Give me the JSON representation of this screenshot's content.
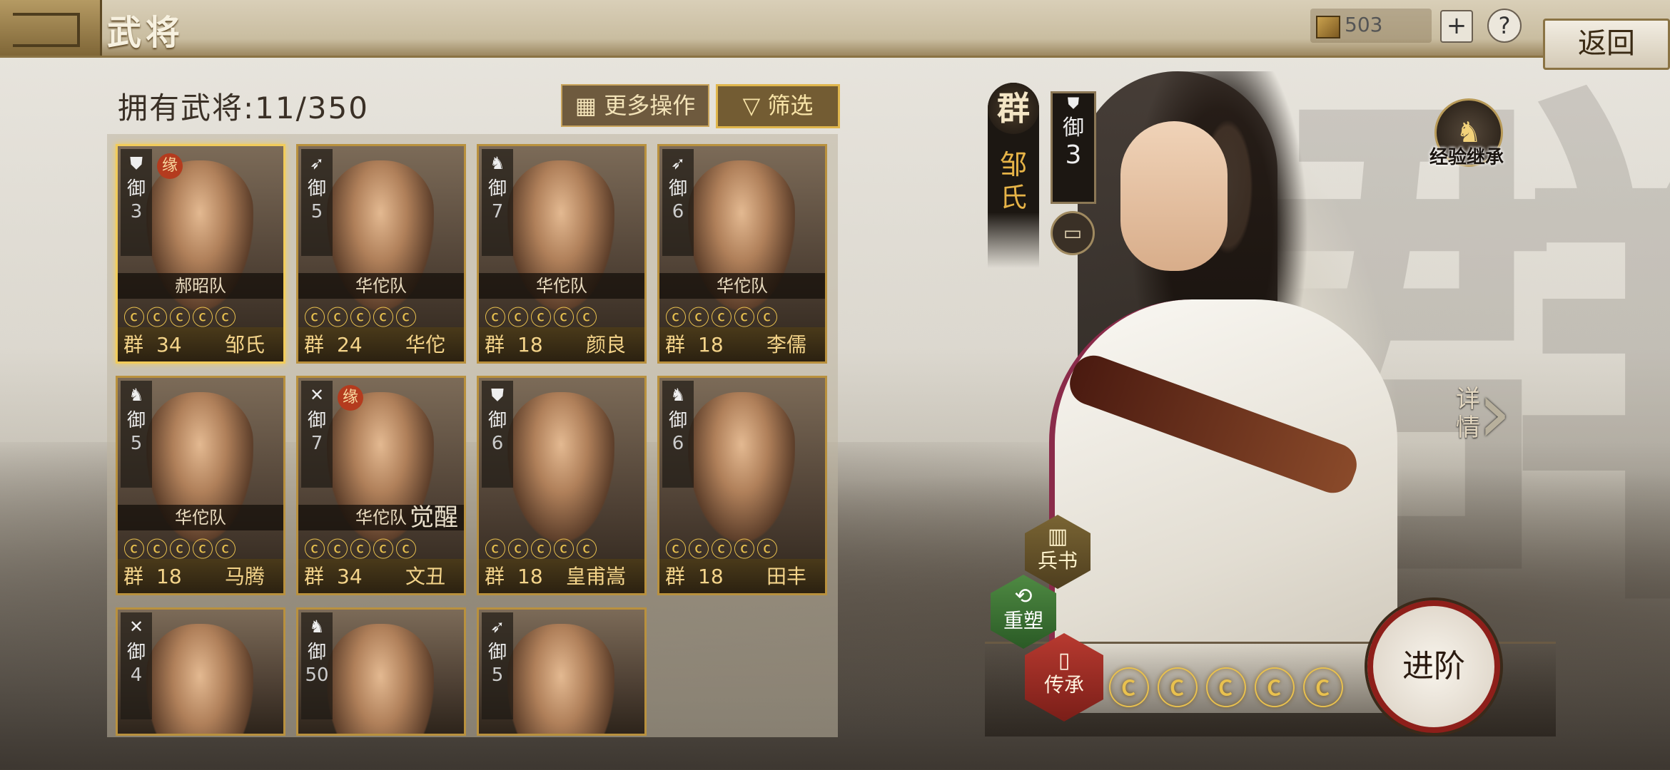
{
  "header": {
    "title": "武将",
    "currency_value": "503",
    "plus_label": "+",
    "help_label": "?",
    "back_label": "返回"
  },
  "panel": {
    "owned_label": "拥有武将:11/350",
    "more_label": "更多操作",
    "filter_label": "筛选"
  },
  "cards": [
    {
      "unit": "御",
      "cost": "3",
      "team": "郝昭队",
      "stars": "ⓒⓒⓒⓒⓒ",
      "faction": "群",
      "level": "34",
      "name": "邹氏",
      "icon": "shield-icon",
      "selected": true,
      "marker": "缘"
    },
    {
      "unit": "御",
      "cost": "5",
      "team": "华佗队",
      "stars": "ⓒⓒⓒⓒⓒ",
      "faction": "群",
      "level": "24",
      "name": "华佗",
      "icon": "bow-icon"
    },
    {
      "unit": "御",
      "cost": "7",
      "team": "华佗队",
      "stars": "ⓒⓒⓒⓒⓒ",
      "faction": "群",
      "level": "18",
      "name": "颜良",
      "icon": "horse-icon"
    },
    {
      "unit": "御",
      "cost": "6",
      "team": "华佗队",
      "stars": "ⓒⓒⓒⓒⓒ",
      "faction": "群",
      "level": "18",
      "name": "李儒",
      "icon": "bow-icon"
    },
    {
      "unit": "御",
      "cost": "5",
      "team": "华佗队",
      "stars": "ⓒⓒⓒⓒⓒ",
      "faction": "群",
      "level": "18",
      "name": "马腾",
      "icon": "horse-icon"
    },
    {
      "unit": "御",
      "cost": "7",
      "team": "华佗队",
      "stars": "ⓒⓒⓒⓒⓒ",
      "faction": "群",
      "level": "34",
      "name": "文丑",
      "icon": "spear-icon",
      "marker": "缘",
      "awake": "觉醒"
    },
    {
      "unit": "御",
      "cost": "6",
      "team": "",
      "stars": "ⓒⓒⓒⓒⓒ",
      "faction": "群",
      "level": "18",
      "name": "皇甫嵩",
      "icon": "shield-icon"
    },
    {
      "unit": "御",
      "cost": "6",
      "team": "",
      "stars": "ⓒⓒⓒⓒⓒ",
      "faction": "群",
      "level": "18",
      "name": "田丰",
      "icon": "horse-icon"
    },
    {
      "unit": "御",
      "cost": "4",
      "team": "",
      "stars": "",
      "faction": "",
      "level": "",
      "name": "",
      "icon": "spear-icon"
    },
    {
      "unit": "御",
      "cost": "50",
      "team": "",
      "stars": "",
      "faction": "",
      "level": "",
      "name": "",
      "icon": "horse-icon"
    },
    {
      "unit": "御",
      "cost": "5",
      "team": "",
      "stars": "",
      "faction": "",
      "level": "",
      "name": "",
      "icon": "bow-icon"
    }
  ],
  "hero": {
    "faction": "群",
    "name": "邹氏",
    "unit": "御",
    "cost": "3",
    "exp_label": "经验继承",
    "detail_label": "详情",
    "book_label": "兵书",
    "reshape_label": "重塑",
    "inherit_label": "传承",
    "stars": "ⓒⓒⓒⓒⓒ",
    "advance_label": "进阶"
  },
  "colors": {
    "gold": "#e9c14e",
    "frame": "#b9913e",
    "accent_red": "#8e1f1a"
  }
}
